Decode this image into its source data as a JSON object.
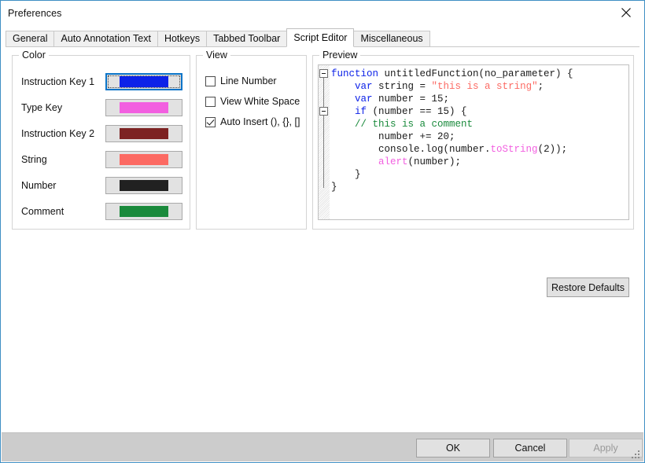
{
  "window": {
    "title": "Preferences",
    "close_icon": "close-icon",
    "accent_border": "#3f8fc4"
  },
  "tabs": [
    {
      "label": "General",
      "active": false
    },
    {
      "label": "Auto Annotation Text",
      "active": false
    },
    {
      "label": "Hotkeys",
      "active": false
    },
    {
      "label": "Tabbed Toolbar",
      "active": false
    },
    {
      "label": "Script Editor",
      "active": true
    },
    {
      "label": "Miscellaneous",
      "active": false
    }
  ],
  "color_group": {
    "label": "Color",
    "items": [
      {
        "label": "Instruction Key 1",
        "color": "#0d22e8",
        "focused": true
      },
      {
        "label": "Type Key",
        "color": "#f25fe0",
        "focused": false
      },
      {
        "label": "Instruction Key 2",
        "color": "#7d2222",
        "focused": false
      },
      {
        "label": "String",
        "color": "#fc6a63",
        "focused": false
      },
      {
        "label": "Number",
        "color": "#212121",
        "focused": false
      },
      {
        "label": "Comment",
        "color": "#1a8a3c",
        "focused": false
      }
    ]
  },
  "view_group": {
    "label": "View",
    "items": [
      {
        "label": "Line Number",
        "checked": false
      },
      {
        "label": "View White Space",
        "checked": false
      },
      {
        "label": "Auto Insert (), {}, []",
        "checked": true
      }
    ]
  },
  "preview_group": {
    "label": "Preview",
    "fold_markers": [
      {
        "line": 0,
        "icon": "fold-collapse-icon"
      },
      {
        "line": 3,
        "icon": "fold-collapse-icon"
      }
    ],
    "code_lines": [
      {
        "tokens": [
          {
            "t": "function",
            "c": "#0d22e8"
          },
          {
            "t": " untitledFunction(no_parameter) {",
            "c": "#1a1a1a"
          }
        ]
      },
      {
        "tokens": [
          {
            "t": "    ",
            "c": "#1a1a1a"
          },
          {
            "t": "var",
            "c": "#0d22e8"
          },
          {
            "t": " string = ",
            "c": "#1a1a1a"
          },
          {
            "t": "\"this is a string\"",
            "c": "#fc6a63"
          },
          {
            "t": ";",
            "c": "#1a1a1a"
          }
        ]
      },
      {
        "tokens": [
          {
            "t": "    ",
            "c": "#1a1a1a"
          },
          {
            "t": "var",
            "c": "#0d22e8"
          },
          {
            "t": " number = 15;",
            "c": "#1a1a1a"
          }
        ]
      },
      {
        "tokens": [
          {
            "t": "    ",
            "c": "#1a1a1a"
          },
          {
            "t": "if",
            "c": "#0d22e8"
          },
          {
            "t": " (number == 15) {",
            "c": "#1a1a1a"
          }
        ]
      },
      {
        "tokens": [
          {
            "t": "    ",
            "c": "#1a1a1a"
          },
          {
            "t": "// this is a comment",
            "c": "#1a8a3c"
          }
        ]
      },
      {
        "tokens": [
          {
            "t": "        number += 20;",
            "c": "#1a1a1a"
          }
        ]
      },
      {
        "tokens": [
          {
            "t": "        console.log(number.",
            "c": "#1a1a1a"
          },
          {
            "t": "toString",
            "c": "#f25fe0"
          },
          {
            "t": "(2));",
            "c": "#1a1a1a"
          }
        ]
      },
      {
        "tokens": [
          {
            "t": "        ",
            "c": "#1a1a1a"
          },
          {
            "t": "alert",
            "c": "#f25fe0"
          },
          {
            "t": "(number);",
            "c": "#1a1a1a"
          }
        ]
      },
      {
        "tokens": [
          {
            "t": "    }",
            "c": "#1a1a1a"
          }
        ]
      },
      {
        "tokens": [
          {
            "t": "}",
            "c": "#1a1a1a"
          }
        ]
      }
    ]
  },
  "actions": {
    "restore_defaults": "Restore Defaults",
    "ok": "OK",
    "cancel": "Cancel",
    "apply": "Apply",
    "apply_disabled": true
  }
}
